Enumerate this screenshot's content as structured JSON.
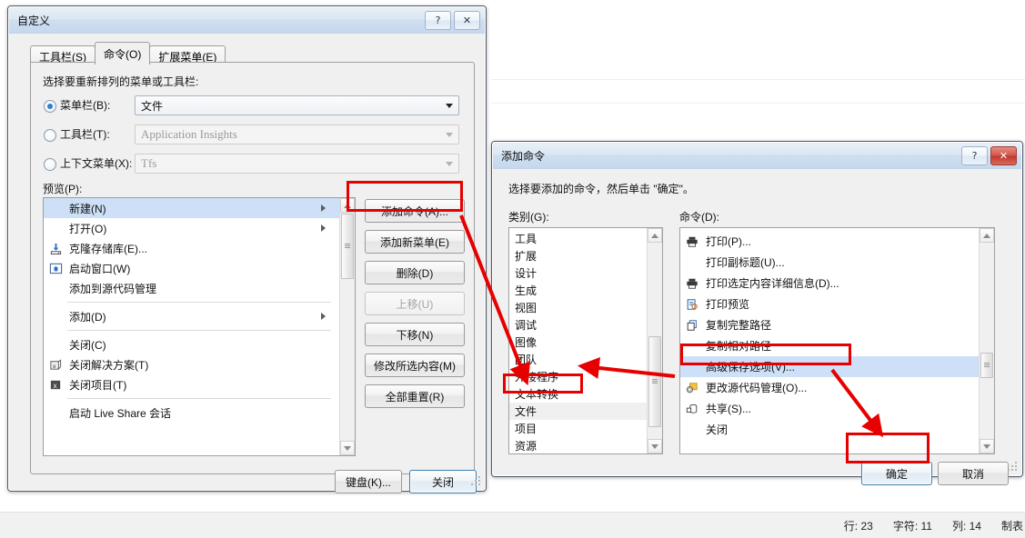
{
  "background": {
    "status_bar": {
      "items": [
        "行: 23",
        "字符: 11",
        "列: 14",
        "制表"
      ]
    }
  },
  "customize_dialog": {
    "title": "自定义",
    "help_button": "?",
    "close_button": "✕",
    "tabs": [
      {
        "label": "工具栏(S)",
        "active": false
      },
      {
        "label": "命令(O)",
        "active": true
      },
      {
        "label": "扩展菜单(E)",
        "active": false
      }
    ],
    "instruction": "选择要重新排列的菜单或工具栏:",
    "radios": [
      {
        "label": "菜单栏(B):",
        "checked": true,
        "value": "文件",
        "enabled": true
      },
      {
        "label": "工具栏(T):",
        "checked": false,
        "value": "Application Insights",
        "enabled": false
      },
      {
        "label": "上下文菜单(X):",
        "checked": false,
        "value": "Tfs",
        "enabled": false
      }
    ],
    "preview_label": "预览(P):",
    "preview_items": [
      {
        "label": "新建(N)",
        "icon": "",
        "submenu": true,
        "selected": true,
        "separator_after": false
      },
      {
        "label": "打开(O)",
        "icon": "",
        "submenu": true,
        "selected": false,
        "separator_after": false
      },
      {
        "label": "克隆存储库(E)...",
        "icon": "clone-repo-icon",
        "submenu": false,
        "selected": false,
        "separator_after": false
      },
      {
        "label": "启动窗口(W)",
        "icon": "start-window-icon",
        "submenu": false,
        "selected": false,
        "separator_after": false
      },
      {
        "label": "添加到源代码管理",
        "icon": "",
        "submenu": false,
        "selected": false,
        "separator_after": true
      },
      {
        "label": "添加(D)",
        "icon": "",
        "submenu": true,
        "selected": false,
        "separator_after": true
      },
      {
        "label": "关闭(C)",
        "icon": "",
        "submenu": false,
        "selected": false,
        "separator_after": false
      },
      {
        "label": "关闭解决方案(T)",
        "icon": "close-solution-icon",
        "submenu": false,
        "selected": false,
        "separator_after": false
      },
      {
        "label": "关闭项目(T)",
        "icon": "close-project-icon",
        "submenu": false,
        "selected": false,
        "separator_after": true
      },
      {
        "label": "启动 Live Share 会话",
        "icon": "",
        "submenu": false,
        "selected": false,
        "separator_after": false
      }
    ],
    "side_buttons": [
      {
        "label": "添加命令(A)...",
        "enabled": true,
        "highlighted": true
      },
      {
        "label": "添加新菜单(E)",
        "enabled": true,
        "highlighted": false
      },
      {
        "label": "删除(D)",
        "enabled": true,
        "highlighted": false
      },
      {
        "label": "上移(U)",
        "enabled": false,
        "highlighted": false
      },
      {
        "label": "下移(N)",
        "enabled": true,
        "highlighted": false
      },
      {
        "label": "修改所选内容(M)",
        "enabled": true,
        "highlighted": false
      },
      {
        "label": "全部重置(R)",
        "enabled": true,
        "highlighted": false
      }
    ],
    "footer_buttons": [
      {
        "label": "键盘(K)...",
        "default": false
      },
      {
        "label": "关闭",
        "default": true
      }
    ]
  },
  "add_command_dialog": {
    "title": "添加命令",
    "help_button": "?",
    "close_button": "✕",
    "instruction": "选择要添加的命令，然后单击 \"确定\"。",
    "category_label": "类别(G):",
    "command_label": "命令(D):",
    "categories": [
      {
        "label": "工具",
        "selected": false
      },
      {
        "label": "扩展",
        "selected": false
      },
      {
        "label": "设计",
        "selected": false
      },
      {
        "label": "生成",
        "selected": false
      },
      {
        "label": "视图",
        "selected": false
      },
      {
        "label": "调试",
        "selected": false
      },
      {
        "label": "图像",
        "selected": false
      },
      {
        "label": "团队",
        "selected": false
      },
      {
        "label": "外接程序",
        "selected": false
      },
      {
        "label": "文本转换",
        "selected": false
      },
      {
        "label": "文件",
        "selected": true
      },
      {
        "label": "项目",
        "selected": false
      },
      {
        "label": "资源",
        "selected": false
      }
    ],
    "commands": [
      {
        "label": "打印(P)...",
        "icon": "printer-icon",
        "selected": false
      },
      {
        "label": "打印副标题(U)...",
        "icon": "",
        "selected": false
      },
      {
        "label": "打印选定内容详细信息(D)...",
        "icon": "printer-icon",
        "selected": false
      },
      {
        "label": "打印预览",
        "icon": "print-preview-icon",
        "selected": false
      },
      {
        "label": "复制完整路径",
        "icon": "copy-icon",
        "selected": false
      },
      {
        "label": "复制相对路径",
        "icon": "",
        "selected": false
      },
      {
        "label": "高级保存选项(V)...",
        "icon": "",
        "selected": true
      },
      {
        "label": "更改源代码管理(O)...",
        "icon": "source-control-icon",
        "selected": false
      },
      {
        "label": "共享(S)...",
        "icon": "share-icon",
        "selected": false
      },
      {
        "label": "关闭",
        "icon": "",
        "selected": false
      }
    ],
    "footer_buttons": [
      {
        "label": "确定",
        "default": true,
        "highlighted": true
      },
      {
        "label": "取消",
        "default": false,
        "highlighted": false
      }
    ]
  },
  "annotations": {
    "accent_color": "#e60000",
    "boxes": [
      "add-command-button",
      "file-category",
      "advanced-save-option",
      "ok-button"
    ],
    "arrows": [
      "add-command-to-file-category",
      "file-category-to-command-list",
      "command-list-to-ok-button"
    ]
  }
}
